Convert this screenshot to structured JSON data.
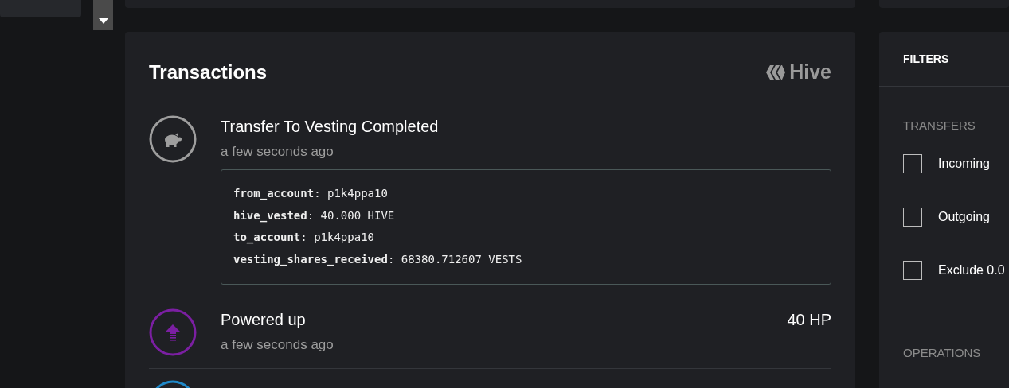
{
  "transactions": {
    "title": "Transactions",
    "brand": "Hive",
    "items": [
      {
        "kind": "savings",
        "color": "#9e9e9e",
        "title": "Transfer To Vesting Completed",
        "time": "a few seconds ago",
        "details": [
          "**from_account**: p1k4ppa10",
          "**hive_vested**: 40.000 HIVE",
          "**to_account**: p1k4ppa10",
          "**vesting_shares_received**: 68380.712607 VESTS"
        ]
      },
      {
        "kind": "power_up",
        "color": "#7b1fa2",
        "title": "Powered up",
        "time": "a few seconds ago",
        "amount": "40 HP"
      },
      {
        "kind": "other",
        "color": "#1e88c8"
      }
    ]
  },
  "filters": {
    "title": "FILTERS",
    "sections": [
      {
        "heading": "TRANSFERS",
        "options": [
          {
            "label": "Incoming",
            "checked": false
          },
          {
            "label": "Outgoing",
            "checked": false
          },
          {
            "label": "Exclude 0.0",
            "checked": false
          }
        ]
      },
      {
        "heading": "OPERATIONS"
      }
    ]
  }
}
